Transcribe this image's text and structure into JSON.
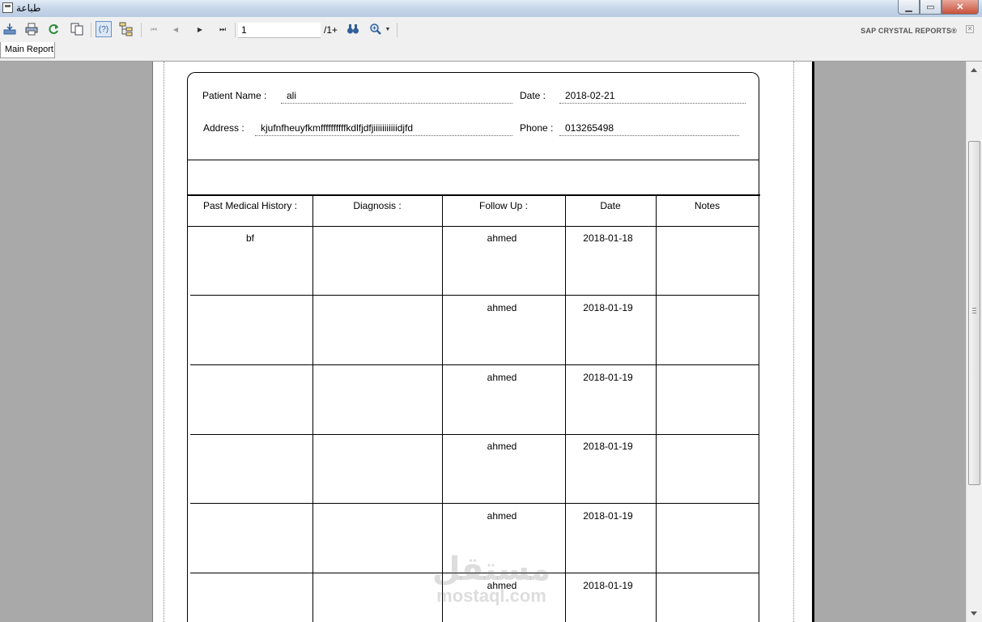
{
  "window": {
    "title": "طباعة",
    "minimize_glyph": "▁",
    "maximize_glyph": "▭",
    "close_glyph": "✕"
  },
  "toolbar": {
    "export_icon": "export-icon",
    "print_icon": "print-icon",
    "refresh_icon": "refresh-icon",
    "copy_icon": "copy-icon",
    "help_icon": "help-icon",
    "group_tree_icon": "group-tree-icon",
    "first_page_glyph": "⏮",
    "prev_page_glyph": "◀",
    "next_page_glyph": "▶",
    "last_page_glyph": "⏭",
    "page_value": "1",
    "page_total": "/1+",
    "find_glyph": "🔍",
    "brand": "SAP CRYSTAL REPORTS®"
  },
  "tabs": [
    {
      "label": "Main Report"
    }
  ],
  "report": {
    "patient_name_label": "Patient Name :",
    "patient_name": "ali",
    "date_label": "Date :",
    "date": "2018-02-21",
    "address_label": "Address :",
    "address": "kjufnfheuyfkmffffffffffkdlfjdfjiiiiiiiiiiidjfd",
    "phone_label": "Phone :",
    "phone": "013265498",
    "columns": [
      "Past Medical History :",
      "Diagnosis :",
      "Follow Up :",
      "Date",
      "Notes"
    ],
    "rows": [
      {
        "history": "bf",
        "diagnosis": "",
        "follow_up": "ahmed",
        "date": "2018-01-18",
        "notes": ""
      },
      {
        "history": "",
        "diagnosis": "",
        "follow_up": "ahmed",
        "date": "2018-01-19",
        "notes": ""
      },
      {
        "history": "",
        "diagnosis": "",
        "follow_up": "ahmed",
        "date": "2018-01-19",
        "notes": ""
      },
      {
        "history": "",
        "diagnosis": "",
        "follow_up": "ahmed",
        "date": "2018-01-19",
        "notes": ""
      },
      {
        "history": "",
        "diagnosis": "",
        "follow_up": "ahmed",
        "date": "2018-01-19",
        "notes": ""
      },
      {
        "history": "",
        "diagnosis": "",
        "follow_up": "ahmed",
        "date": "2018-01-19",
        "notes": ""
      }
    ]
  },
  "watermark": {
    "arabic": "مستقل",
    "latin": "mostaql.com"
  }
}
